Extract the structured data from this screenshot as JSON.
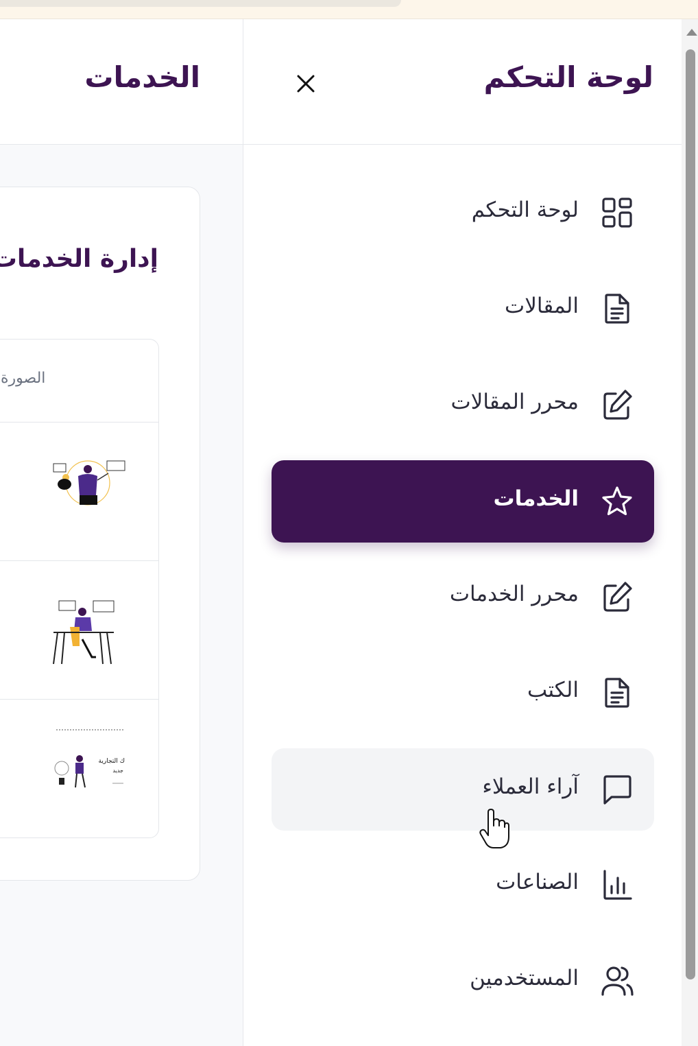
{
  "main": {
    "title": "الخدمات",
    "card_title": "إدارة الخدمات",
    "table_header": "الصورة",
    "rows": [
      {
        "thumb": "illustration-person-with-charts"
      },
      {
        "thumb": "illustration-person-at-desk"
      },
      {
        "thumb": "illustration-ecommerce-banner",
        "text_line1": "ك التجارية",
        "text_line2": "جديد"
      }
    ]
  },
  "sidebar": {
    "title": "لوحة التحكم",
    "close_icon": "close-icon",
    "items": [
      {
        "label": "لوحة التحكم",
        "icon": "dashboard-grid-icon"
      },
      {
        "label": "المقالات",
        "icon": "document-icon"
      },
      {
        "label": "محرر المقالات",
        "icon": "edit-icon"
      },
      {
        "label": "الخدمات",
        "icon": "star-icon",
        "active": true
      },
      {
        "label": "محرر الخدمات",
        "icon": "edit-icon"
      },
      {
        "label": "الكتب",
        "icon": "document-icon"
      },
      {
        "label": "آراء العملاء",
        "icon": "message-icon",
        "hover": true
      },
      {
        "label": "الصناعات",
        "icon": "bar-chart-icon"
      },
      {
        "label": "المستخدمين",
        "icon": "users-icon"
      }
    ]
  },
  "colors": {
    "brand": "#3d1452",
    "text": "#2b2b3a",
    "hover_bg": "#f3f4f6"
  }
}
